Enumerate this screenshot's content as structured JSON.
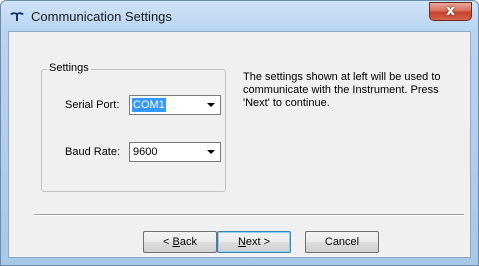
{
  "window": {
    "title": "Communication Settings",
    "close_label": "x"
  },
  "settings": {
    "group_label": "Settings",
    "serial_port_label": "Serial Port:",
    "serial_port_value": "COM1",
    "baud_rate_label": "Baud Rate:",
    "baud_rate_value": "9600"
  },
  "info": {
    "text": "The settings shown at left will be used to communicate with the Instrument. Press 'Next' to continue."
  },
  "buttons": {
    "back_prefix": "< ",
    "back_mnemonic": "B",
    "back_rest": "ack",
    "next_mnemonic": "N",
    "next_rest": "ext >",
    "cancel_label": "Cancel"
  }
}
